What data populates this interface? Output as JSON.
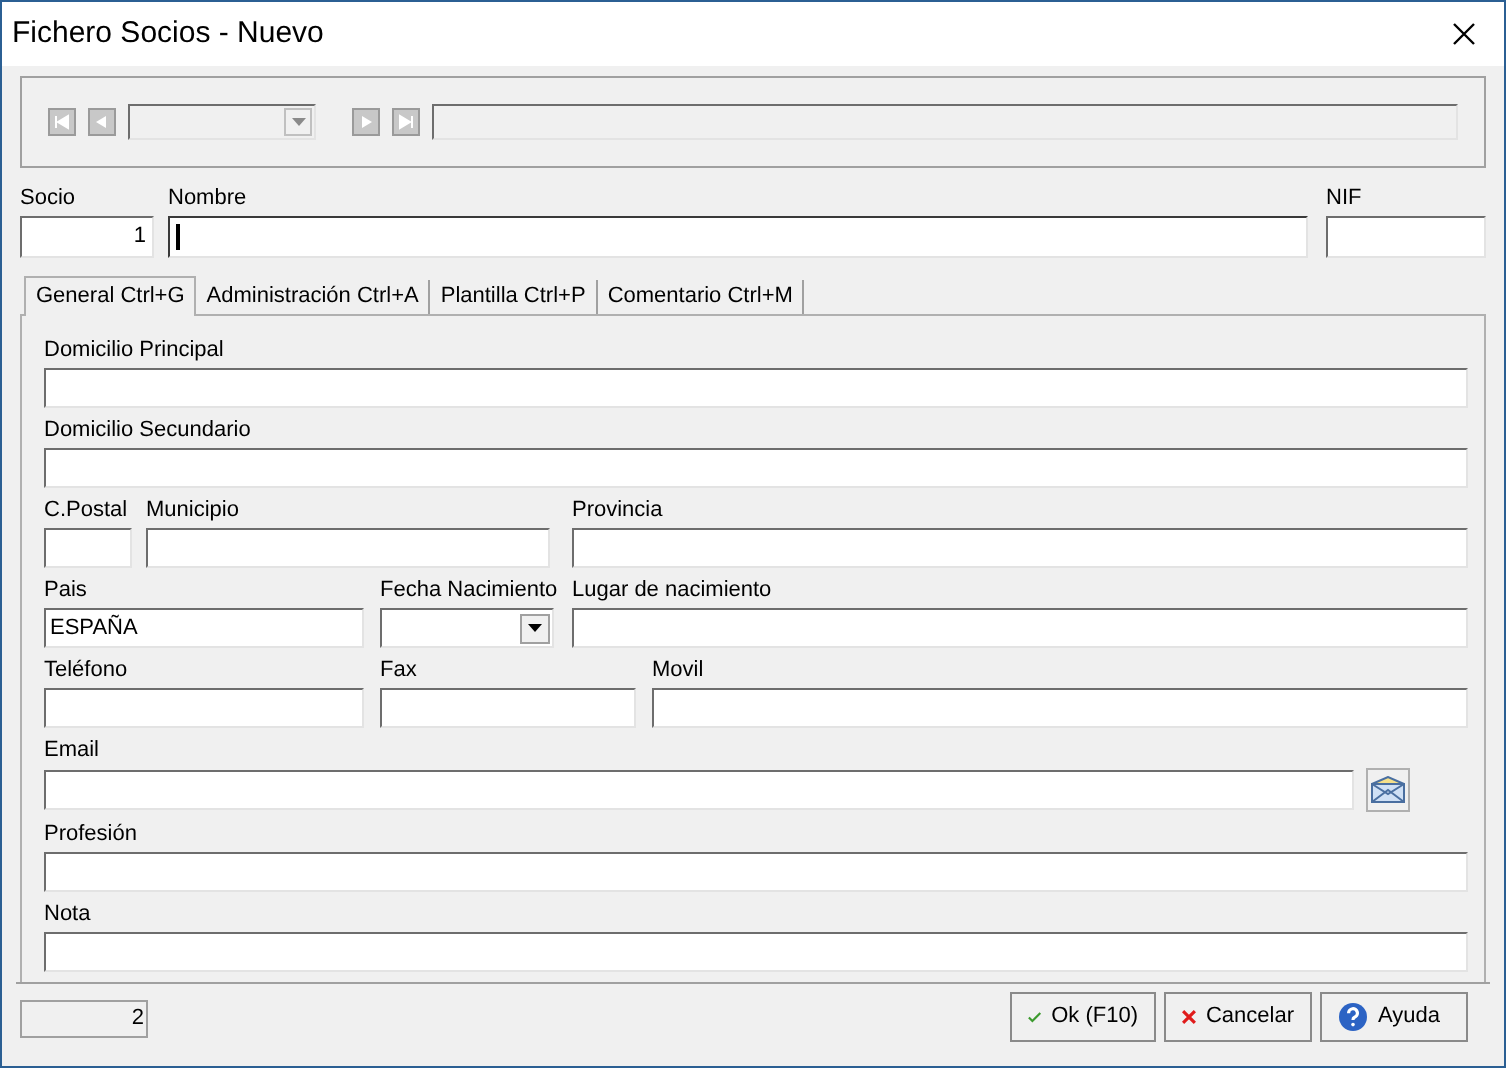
{
  "window": {
    "title": "Fichero Socios - Nuevo"
  },
  "header_fields": [
    {
      "label": "Socio",
      "value": "1",
      "focused": false
    },
    {
      "label": "Nombre",
      "focused": true
    },
    {
      "label": "NIF",
      "focused": false
    }
  ],
  "tabs": [
    {
      "label": "General Ctrl+G",
      "selected": true
    },
    {
      "label": "Administración Ctrl+A",
      "selected": false
    },
    {
      "label": "Plantilla Ctrl+P",
      "selected": false
    },
    {
      "label": "Comentario Ctrl+M",
      "selected": false
    }
  ],
  "form_rows": [
    [
      {
        "label": "Domicilio Principal",
        "kind": "text"
      }
    ],
    [
      {
        "label": "Domicilio Secundario",
        "kind": "text"
      }
    ],
    [
      {
        "label": "C.Postal",
        "kind": "text"
      },
      {
        "label": "Municipio",
        "kind": "text"
      },
      {
        "label": "Provincia",
        "kind": "text"
      }
    ],
    [
      {
        "label": "Pais",
        "kind": "text",
        "value": "ESPAÑA"
      },
      {
        "label": "Fecha Nacimiento",
        "kind": "date"
      },
      {
        "label": "Lugar de nacimiento",
        "kind": "text"
      }
    ],
    [
      {
        "label": "Teléfono",
        "kind": "text"
      },
      {
        "label": "Fax",
        "kind": "text"
      },
      {
        "label": "Movil",
        "kind": "text"
      }
    ],
    [
      {
        "label": "Email",
        "kind": "email"
      }
    ],
    [
      {
        "label": "Profesión",
        "kind": "text"
      }
    ],
    [
      {
        "label": "Nota",
        "kind": "text"
      }
    ]
  ],
  "status": {
    "count": "2"
  },
  "buttons": [
    {
      "label": "Ok (F10)",
      "kind": "ok"
    },
    {
      "label": "Cancelar",
      "kind": "cancel"
    },
    {
      "label": "Ayuda",
      "kind": "help"
    }
  ]
}
